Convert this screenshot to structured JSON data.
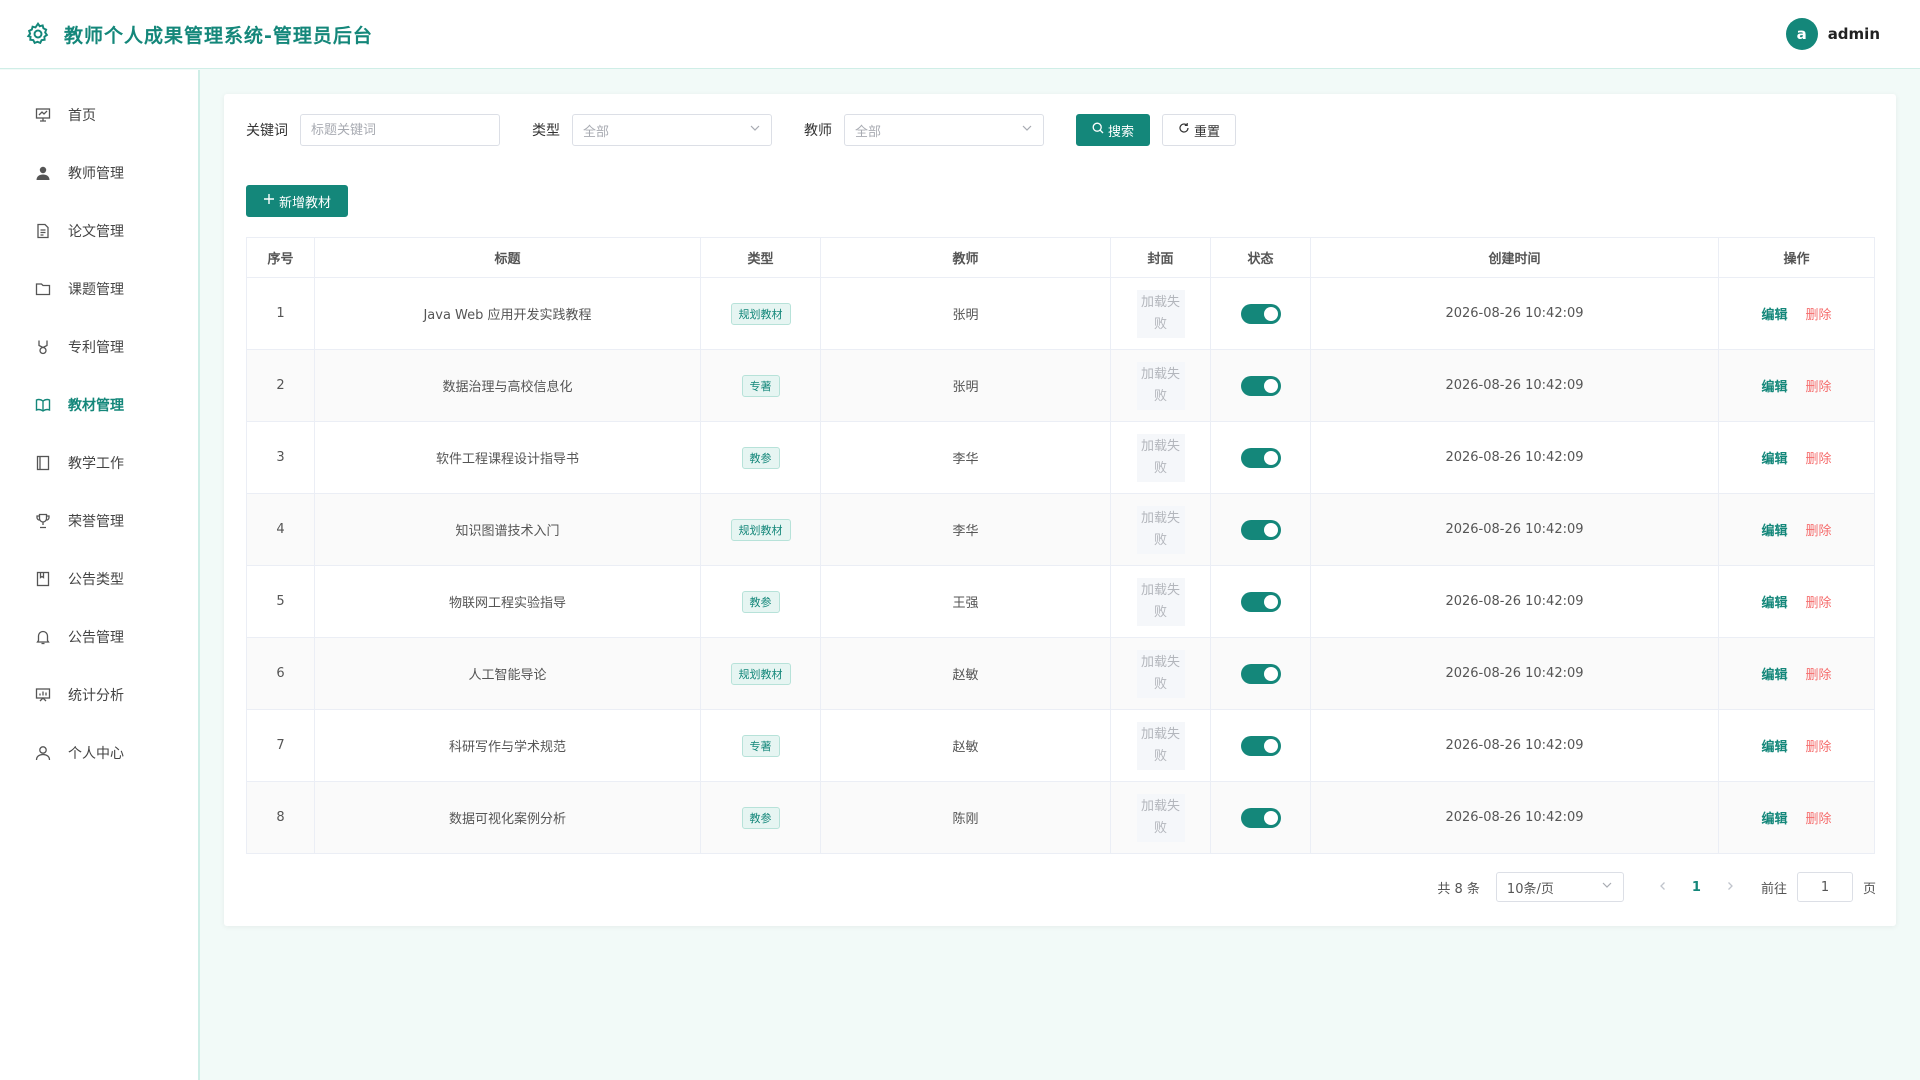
{
  "app": {
    "title": "教师个人成果管理系统-管理员后台",
    "accent": "#14877a"
  },
  "user": {
    "avatar_letter": "a",
    "name": "admin"
  },
  "sidebar": {
    "items": [
      {
        "label": "首页",
        "icon": "presentation-icon"
      },
      {
        "label": "教师管理",
        "icon": "user-filled-icon"
      },
      {
        "label": "论文管理",
        "icon": "document-icon"
      },
      {
        "label": "课题管理",
        "icon": "folder-icon"
      },
      {
        "label": "专利管理",
        "icon": "medal-icon"
      },
      {
        "label": "教材管理",
        "icon": "book-icon",
        "active": true
      },
      {
        "label": "教学工作",
        "icon": "notebook-icon"
      },
      {
        "label": "荣誉管理",
        "icon": "trophy-icon"
      },
      {
        "label": "公告类型",
        "icon": "tickets-icon"
      },
      {
        "label": "公告管理",
        "icon": "bell-icon"
      },
      {
        "label": "统计分析",
        "icon": "chart-board-icon"
      },
      {
        "label": "个人中心",
        "icon": "user-icon"
      }
    ]
  },
  "filters": {
    "keyword_label": "关键词",
    "keyword_placeholder": "标题关键词",
    "type_label": "类型",
    "type_value": "全部",
    "teacher_label": "教师",
    "teacher_value": "全部",
    "search_label": "搜索",
    "reset_label": "重置"
  },
  "actions": {
    "add_label": "新增教材"
  },
  "table": {
    "headers": [
      "序号",
      "标题",
      "类型",
      "教师",
      "封面",
      "状态",
      "创建时间",
      "操作"
    ],
    "cover_text": "加载失败",
    "edit_label": "编辑",
    "delete_label": "删除",
    "rows": [
      {
        "no": "1",
        "title": "Java Web 应用开发实践教程",
        "type": "规划教材",
        "teacher": "张明",
        "status": true,
        "created": "2026-08-26 10:42:09"
      },
      {
        "no": "2",
        "title": "数据治理与高校信息化",
        "type": "专著",
        "teacher": "张明",
        "status": true,
        "created": "2026-08-26 10:42:09"
      },
      {
        "no": "3",
        "title": "软件工程课程设计指导书",
        "type": "教参",
        "teacher": "李华",
        "status": true,
        "created": "2026-08-26 10:42:09"
      },
      {
        "no": "4",
        "title": "知识图谱技术入门",
        "type": "规划教材",
        "teacher": "李华",
        "status": true,
        "created": "2026-08-26 10:42:09"
      },
      {
        "no": "5",
        "title": "物联网工程实验指导",
        "type": "教参",
        "teacher": "王强",
        "status": true,
        "created": "2026-08-26 10:42:09"
      },
      {
        "no": "6",
        "title": "人工智能导论",
        "type": "规划教材",
        "teacher": "赵敏",
        "status": true,
        "created": "2026-08-26 10:42:09"
      },
      {
        "no": "7",
        "title": "科研写作与学术规范",
        "type": "专著",
        "teacher": "赵敏",
        "status": true,
        "created": "2026-08-26 10:42:09"
      },
      {
        "no": "8",
        "title": "数据可视化案例分析",
        "type": "教参",
        "teacher": "陈刚",
        "status": true,
        "created": "2026-08-26 10:42:09"
      }
    ]
  },
  "pagination": {
    "total_text": "共 8 条",
    "page_size": "10条/页",
    "current_page": "1",
    "goto_label": "前往",
    "goto_value": "1",
    "page_suffix": "页"
  }
}
